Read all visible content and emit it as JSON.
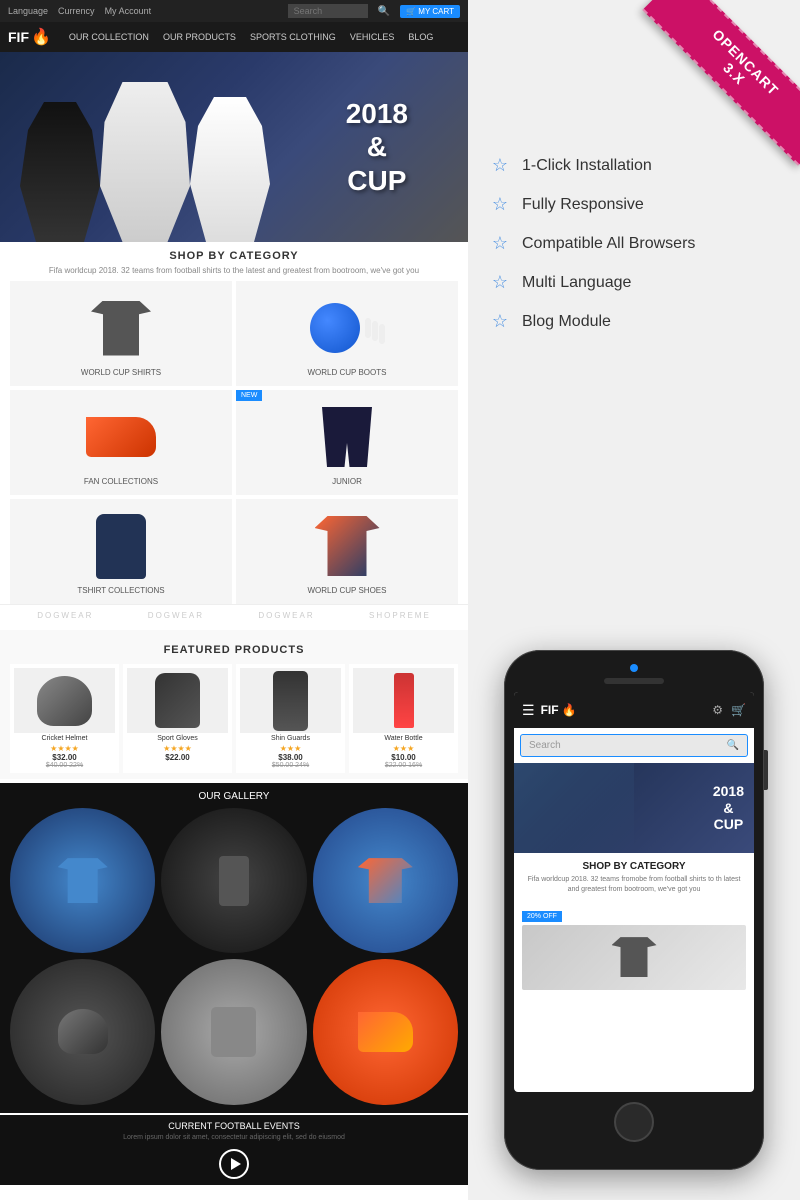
{
  "left": {
    "topbar": {
      "language": "Language",
      "currency": "Currency",
      "account": "My Account",
      "cart": "🛒 MY CART"
    },
    "nav": {
      "logo": "FIF",
      "fire": "🔥",
      "items": [
        "OUR COLLECTION",
        "OUR PRODUCTS",
        "SPORTS CLOTHING",
        "VEHICLES",
        "BLOG"
      ]
    },
    "hero": {
      "line1": "2018",
      "line2": "&",
      "line3": "CUP"
    },
    "shopByCategory": {
      "title": "SHOP BY CATEGORY",
      "subtitle": "Fifa worldcup 2018. 32 teams from football shirts to the latest and greatest from bootroom, we've got you",
      "categories": [
        {
          "label": "WORLD CUP SHIRTS",
          "badge": ""
        },
        {
          "label": "WORLD CUP BOOTS",
          "badge": ""
        },
        {
          "label": "FAN COLLECTIONS",
          "badge": ""
        },
        {
          "label": "JUNIOR",
          "badge": "NEW"
        },
        {
          "label": "TSHIRT COLLECTIONS",
          "badge": ""
        },
        {
          "label": "WORLD CUP SHOES",
          "badge": ""
        }
      ]
    },
    "brands": [
      "DOGWEAR",
      "DOGWEAR",
      "DOGWEAR",
      "SHOPREME"
    ],
    "featuredProducts": {
      "title": "FEATURED PRODUCTS",
      "products": [
        {
          "name": "Cricket Helmet",
          "stars": "★★★★",
          "price": "$32.00",
          "oldPrice": "$40.00 22%"
        },
        {
          "name": "Sport Gloves",
          "stars": "★★★★",
          "price": "$22.00",
          "oldPrice": ""
        },
        {
          "name": "Shin Guards",
          "stars": "★★★",
          "price": "$38.00",
          "oldPrice": "$50.00 24%"
        },
        {
          "name": "Water Bottle",
          "stars": "★★★",
          "price": "$10.00",
          "oldPrice": "$22.00 16%"
        }
      ]
    },
    "gallery": {
      "title": "OUR GALLERY",
      "items": [
        "jacket",
        "shin",
        "jacket2",
        "helmet",
        "bag",
        "shoes"
      ]
    },
    "footer": {
      "title": "CURRENT FOOTBALL EVENTS",
      "subtitle": "Lorem ipsum dolor sit amet, consectetur adipiscing elit, sed do eiusmod"
    }
  },
  "right": {
    "ribbon": {
      "line1": "OPENCART",
      "line2": "3.X"
    },
    "features": [
      {
        "icon": "☆",
        "text": "1-Click Installation"
      },
      {
        "icon": "☆",
        "text": "Fully Responsive"
      },
      {
        "icon": "☆",
        "text": "Compatible All Browsers"
      },
      {
        "icon": "☆",
        "text": "Multi Language"
      },
      {
        "icon": "☆",
        "text": "Blog Module"
      }
    ],
    "phone": {
      "logo": "FIF",
      "fire": "🔥",
      "searchPlaceholder": "Search",
      "heroText": {
        "line1": "2018",
        "line2": "&",
        "line3": "CUP"
      },
      "shopTitle": "SHOP BY CATEGORY",
      "shopDesc": "Fifa worldcup 2018. 32 teams fromobe from football shirts to th latest and greatest from bootroom, we've got you",
      "badge": "20% OFF"
    }
  }
}
